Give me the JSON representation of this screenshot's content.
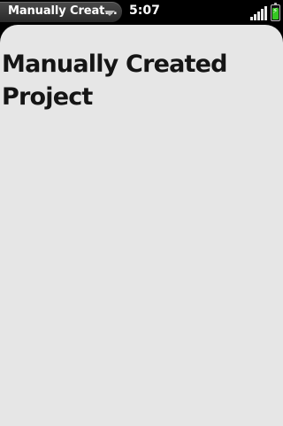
{
  "status_bar": {
    "app_title": "Manually Creat...",
    "time": "5:07",
    "signal_level": 5,
    "battery_level": 0.85,
    "battery_color": "#36c823"
  },
  "main": {
    "title": "Manually Created Project"
  }
}
